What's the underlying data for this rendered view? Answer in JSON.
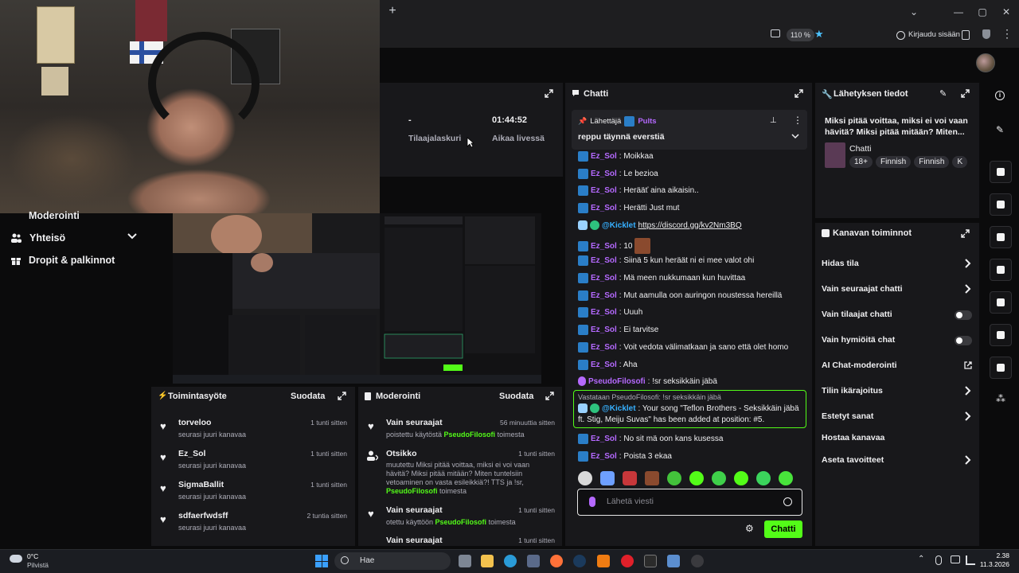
{
  "browser": {
    "new_tab": "+",
    "zoom": "110 %",
    "sign_in": "Kirjaudu sisään"
  },
  "left_nav": {
    "items": [
      {
        "label": "Moderointi"
      },
      {
        "label": "Yhteisö"
      },
      {
        "label": "Dropit & palkinnot"
      }
    ]
  },
  "stats": {
    "subs_value": "-",
    "subs_label": "Tilaajalaskuri",
    "live_value": "01:44:52",
    "live_label": "Aikaa livessä"
  },
  "chat": {
    "title": "Chatti",
    "pinned": {
      "by_label": "Lähettäjä",
      "by_user": "Pults",
      "message": "reppu täynnä everstiä"
    },
    "messages": [
      {
        "user": "Ez_Sol",
        "text": ": Moikkaa"
      },
      {
        "user": "Ez_Sol",
        "text": ": Le bezioa"
      },
      {
        "user": "Ez_Sol",
        "text": ": Herääť aina aikaisin.."
      },
      {
        "user": "Ez_Sol",
        "text": ": Herätti Just mut"
      },
      {
        "user": "@Kicklet",
        "text": "https://discord.gg/kv2Nm3BQ"
      },
      {
        "user": "Ez_Sol",
        "text": ": 10"
      },
      {
        "user": "Ez_Sol",
        "text": ": Siinä 5 kun heräät ni ei mee valot ohi"
      },
      {
        "user": "Ez_Sol",
        "text": ": Mä meen nukkumaan kun huvittaa"
      },
      {
        "user": "Ez_Sol",
        "text": ": Mut aamulla oon auringon noustessa hereillä"
      },
      {
        "user": "Ez_Sol",
        "text": ": Uuuh"
      },
      {
        "user": "Ez_Sol",
        "text": ": Ei tarvitse"
      },
      {
        "user": "Ez_Sol",
        "text": ": Voit vedota välimatkaan ja sano että olet homo"
      },
      {
        "user": "Ez_Sol",
        "text": ": Aha"
      },
      {
        "user": "PseudoFilosofi",
        "text": ": !sr seksikkäin jäbä"
      }
    ],
    "reply": {
      "context": "Vastataan PseudoFilosofi: !sr seksikkäin jäbä",
      "user": "@Kicklet",
      "text_line1": ": Your song \"Teflon Brothers - Seksikkäin jäbä",
      "text_line2": "ft. Stig, Meiju Suvas\" has been added at position: #5."
    },
    "after": [
      {
        "user": "Ez_Sol",
        "text": ": No sit mä oon kans kusessa"
      },
      {
        "user": "Ez_Sol",
        "text": ": Poista 3 ekaa"
      }
    ],
    "input_placeholder": "Lähetä viesti",
    "send_label": "Chatti"
  },
  "stream_info": {
    "title": "Lähetyksen tiedot",
    "stream_title": "Miksi pitää voittaa, miksi ei voi vaan hävitä? Miksi pitää mitään? Miten...",
    "category": "Chatti",
    "tags": [
      "18+",
      "Finnish",
      "Finnish",
      "K"
    ]
  },
  "channel_actions": {
    "title": "Kanavan toiminnot",
    "items": [
      {
        "label": "Hidas tila",
        "control": "chevron"
      },
      {
        "label": "Vain seuraajat chatti",
        "control": "chevron"
      },
      {
        "label": "Vain tilaajat chatti",
        "control": "toggle"
      },
      {
        "label": "Vain hymiöitä chat",
        "control": "toggle"
      },
      {
        "label": "AI Chat-moderointi",
        "control": "external"
      },
      {
        "label": "Tilin ikärajoitus",
        "control": "chevron"
      },
      {
        "label": "Estetyt sanat",
        "control": "chevron"
      },
      {
        "label": "Hostaa kanavaa",
        "control": "none"
      },
      {
        "label": "Aseta tavoitteet",
        "control": "chevron"
      }
    ]
  },
  "activity": {
    "title": "Toimintasyöte",
    "filter": "Suodata",
    "items": [
      {
        "name": "torveloo",
        "sub": "seurasi juuri kanavaa",
        "time": "1 tunti sitten"
      },
      {
        "name": "Ez_Sol",
        "sub": "seurasi juuri kanavaa",
        "time": "1 tunti sitten"
      },
      {
        "name": "SigmaBallit",
        "sub": "seurasi juuri kanavaa",
        "time": "1 tunti sitten"
      },
      {
        "name": "sdfaerfwdsff",
        "sub": "seurasi juuri kanavaa",
        "time": "2 tuntia sitten"
      }
    ]
  },
  "moderation": {
    "title": "Moderointi",
    "filter": "Suodata",
    "items": [
      {
        "name": "Vain seuraajat",
        "time": "56 minuuttia sitten",
        "line1_pre": "poistettu käytöstä ",
        "line1_user": "PseudoFilosofi",
        "line1_post": " toimesta"
      },
      {
        "name": "Otsikko",
        "time": "1 tunti sitten",
        "line1_pre": "muutettu Miksi pitää voittaa, miksi ei voi vaan",
        "line2": "hävitä? Miksi pitää mitään? Miten tuntelsiin",
        "line3": "vetoaminen on vasta esileikkiä?! TTS ja !sr,",
        "line4_user": "PseudoFilosofi",
        "line4_post": " toimesta"
      },
      {
        "name": "Vain seuraajat",
        "time": "1 tunti sitten",
        "line1_pre": "otettu käyttöön ",
        "line1_user": "PseudoFilosofi",
        "line1_post": " toimesta"
      },
      {
        "name": "Vain seuraajat",
        "time": "1 tunti sitten"
      }
    ]
  },
  "taskbar": {
    "weather_temp": "0°C",
    "weather_desc": "Pilvistä",
    "search_label": "Hae",
    "time": "2.38",
    "date": "11.3.2026"
  },
  "colors": {
    "kick_green": "#53fc18",
    "panel_bg": "#18181b",
    "page_bg": "#0b0b0c",
    "username_purple": "#b569ff",
    "link_blue": "#36b0ff"
  }
}
